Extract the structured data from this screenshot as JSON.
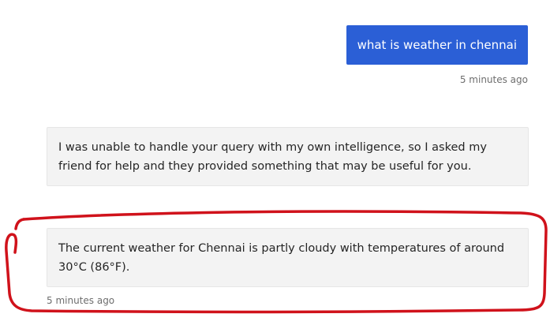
{
  "messages": [
    {
      "role": "user",
      "text": "what is weather in chennai",
      "timestamp": "5 minutes ago"
    },
    {
      "role": "bot",
      "text": "I was unable to handle your query with my own intelligence, so I asked my friend for help and they provided something that may be useful for you."
    },
    {
      "role": "bot",
      "text": "The current weather for Chennai is partly cloudy with temperatures of around 30°C (86°F).",
      "timestamp": "5 minutes ago"
    }
  ],
  "colors": {
    "user_bubble": "#2b5fd6",
    "bot_bubble": "#f3f3f3",
    "annotation": "#d0121b"
  }
}
